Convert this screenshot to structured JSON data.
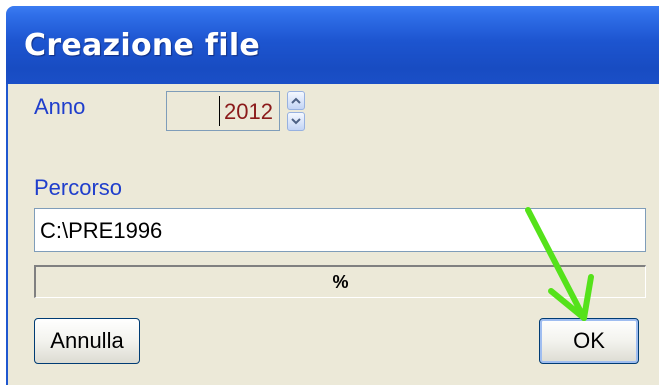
{
  "window": {
    "title": "Creazione file"
  },
  "form": {
    "anno_label": "Anno",
    "anno_value": "2012",
    "percorso_label": "Percorso",
    "percorso_value": "C:\\PRE1996"
  },
  "progress": {
    "text": "%",
    "fraction": 0
  },
  "buttons": {
    "cancel_label": "Annulla",
    "ok_label": "OK"
  },
  "icons": {
    "spin_up": "chevron-up-icon",
    "spin_down": "chevron-down-icon",
    "annotation": "green-arrow-icon"
  },
  "colors": {
    "title_bar": "#1d55d0",
    "window_bg": "#ece9d8",
    "label_text": "#1f3ecc",
    "anno_text": "#8b1a1a",
    "annotation_arrow": "#55e21a"
  }
}
